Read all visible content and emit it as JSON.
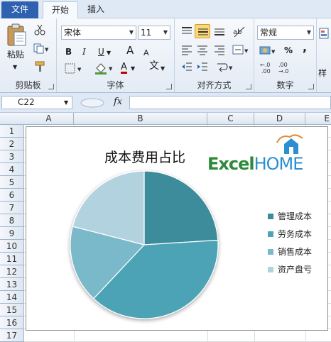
{
  "tabs": [
    {
      "label": "文件"
    },
    {
      "label": "开始"
    },
    {
      "label": "插入"
    }
  ],
  "clipboard": {
    "paste_label": "粘贴",
    "group_label": "剪贴板"
  },
  "font": {
    "name": "宋体",
    "size": "11",
    "group_label": "字体",
    "bold": "B",
    "italic": "I",
    "underline": "U",
    "grow": "A",
    "shrink": "A",
    "font_color": "A",
    "phonetic": "文"
  },
  "alignment": {
    "group_label": "对齐方式"
  },
  "number": {
    "format": "常规",
    "group_label": "数字",
    "percent": "%",
    "comma": ","
  },
  "right_cut": {
    "label": "样"
  },
  "formula_bar": {
    "name_box": "C22",
    "fx": "fx"
  },
  "columns": [
    {
      "label": "A"
    },
    {
      "label": "B"
    },
    {
      "label": "C"
    },
    {
      "label": "D"
    },
    {
      "label": "E"
    }
  ],
  "rows": [
    "1",
    "2",
    "3",
    "4",
    "5",
    "6",
    "7",
    "8",
    "9",
    "10",
    "11",
    "12",
    "13",
    "14",
    "15",
    "16",
    "17"
  ],
  "logo": {
    "excel": "Excel",
    "home": "HOME"
  },
  "chart_data": {
    "type": "pie",
    "title": "成本费用占比",
    "categories": [
      "管理成本",
      "劳务成本",
      "销售成本",
      "资产盘亏"
    ],
    "values": [
      24,
      38,
      17,
      21
    ],
    "colors": [
      "#3d8c9c",
      "#4ea3b6",
      "#7ab9c9",
      "#b3d2df"
    ],
    "legend_position": "right"
  }
}
